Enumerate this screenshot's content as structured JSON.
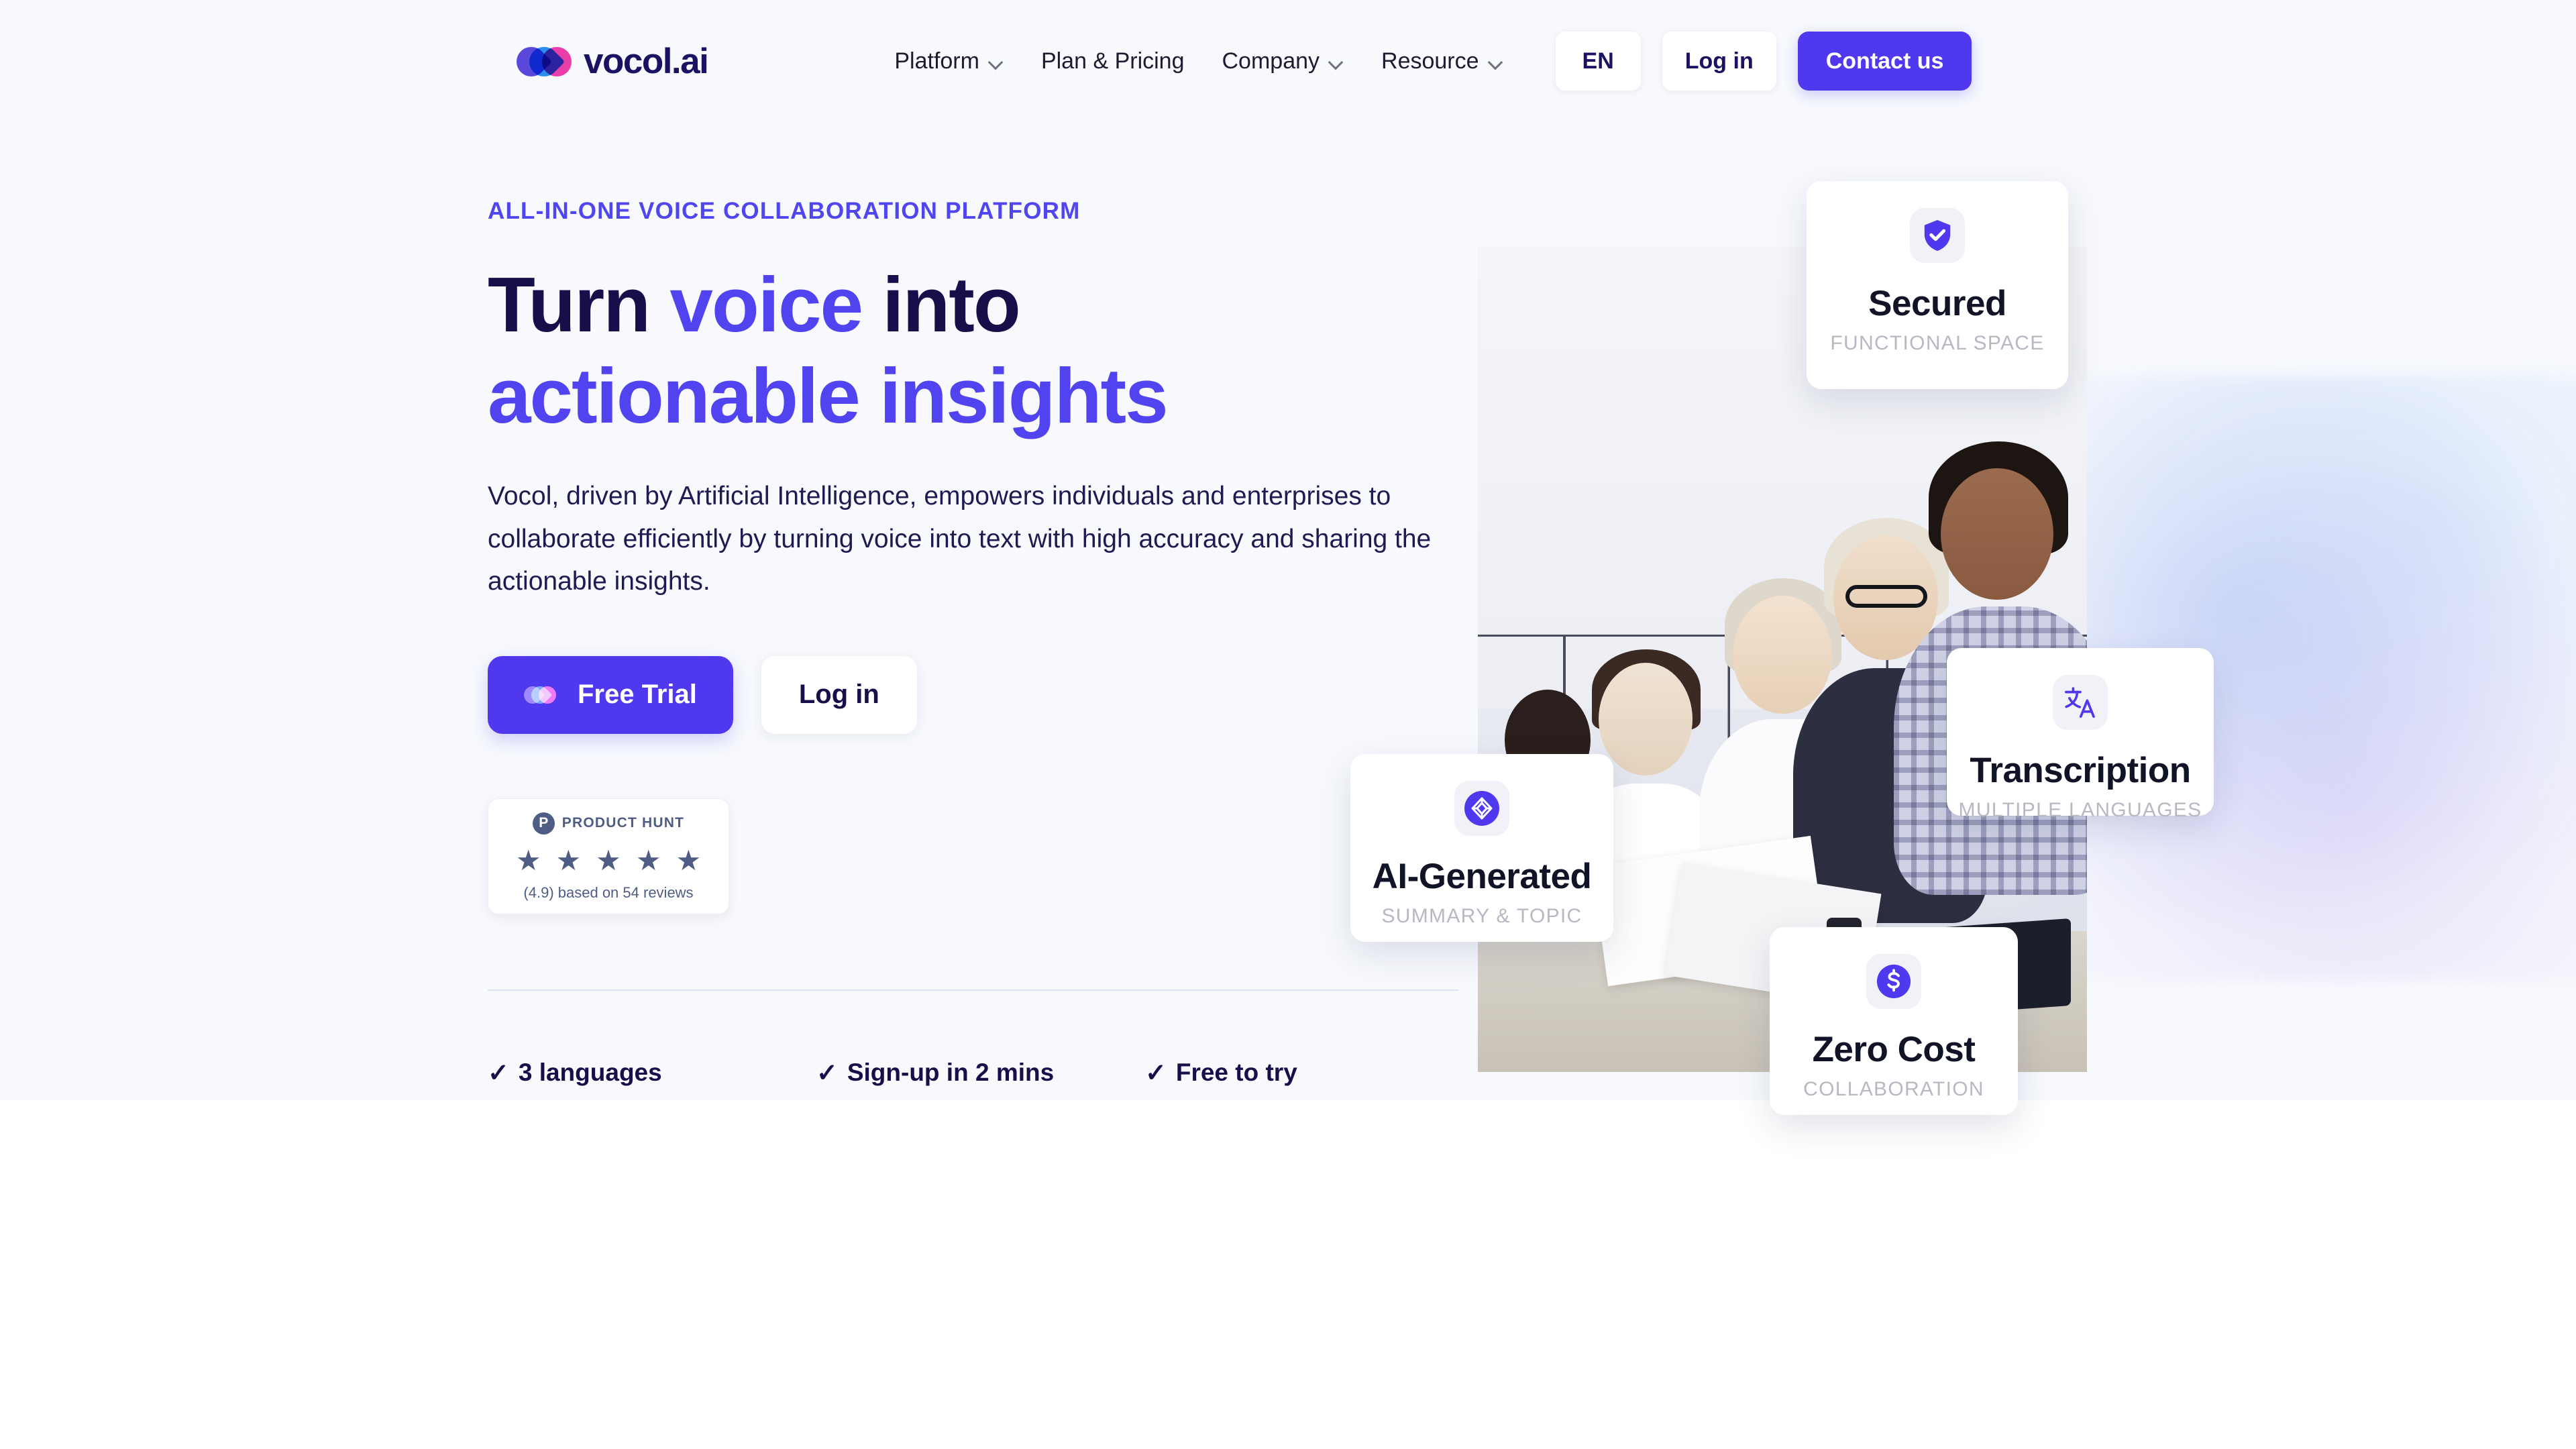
{
  "brand": {
    "name": "vocol.ai",
    "logo_icon": "vocol-leaves-icon"
  },
  "nav": {
    "links": [
      {
        "label": "Platform",
        "has_dropdown": true
      },
      {
        "label": "Plan & Pricing",
        "has_dropdown": false
      },
      {
        "label": "Company",
        "has_dropdown": true
      },
      {
        "label": "Resource",
        "has_dropdown": true
      }
    ],
    "language": "EN",
    "login": "Log in",
    "contact": "Contact us"
  },
  "hero": {
    "eyebrow": "ALL-IN-ONE VOICE COLLABORATION PLATFORM",
    "headline_line1_pre": "Turn ",
    "headline_line1_accent": "voice",
    "headline_line1_post": " into",
    "headline_line2": "actionable insights",
    "subcopy": "Vocol, driven by Artificial Intelligence, empowers individuals and enterprises to collaborate efficiently by turning voice into text with high accuracy and sharing the actionable insights.",
    "cta_primary": "Free Trial",
    "cta_secondary": "Log in"
  },
  "product_hunt": {
    "name": "PRODUCT HUNT",
    "logo_letter": "P",
    "stars": [
      "★",
      "★",
      "★",
      "★",
      "★"
    ],
    "rating_text": "(4.9) based on 54 reviews"
  },
  "features": [
    {
      "check": "✓",
      "label": "3 languages"
    },
    {
      "check": "✓",
      "label": "Sign-up in 2 mins"
    },
    {
      "check": "✓",
      "label": "Free to try"
    }
  ],
  "cards": [
    {
      "title": "Secured",
      "subtitle": "FUNCTIONAL SPACE",
      "icon": "shield-check-icon"
    },
    {
      "title": "Transcription",
      "subtitle": "MULTIPLE LANGUAGES",
      "icon": "translate-icon"
    },
    {
      "title": "AI-Generated",
      "subtitle": "SUMMARY & TOPIC",
      "icon": "ai-cube-icon"
    },
    {
      "title": "Zero Cost",
      "subtitle": "COLLABORATION",
      "icon": "dollar-circle-icon"
    }
  ],
  "colors": {
    "primary": "#4f39ef",
    "accent_text": "#5143ef",
    "heading": "#160f4a",
    "page_bg": "#f7f9fd",
    "product_hunt": "#4f5d84",
    "logo_purple": "#5b4bdd",
    "logo_blue": "#2e8ef0",
    "logo_pink": "#ef3fa8"
  }
}
